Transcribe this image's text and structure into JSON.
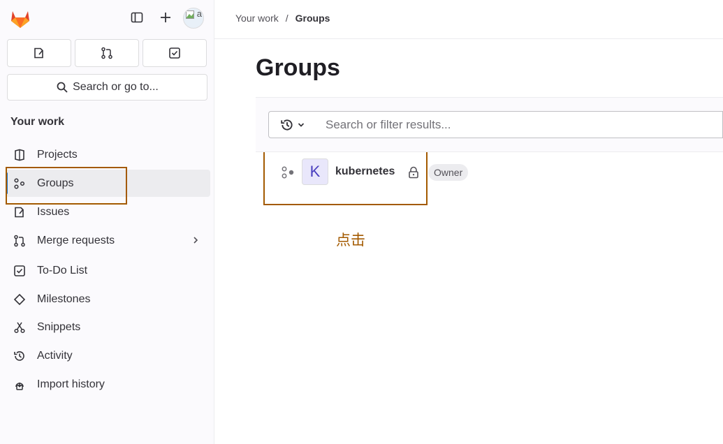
{
  "sidebar": {
    "section_title": "Your work",
    "search_label": "Search or go to...",
    "avatar_alt": "a",
    "items": [
      {
        "label": "Projects"
      },
      {
        "label": "Groups"
      },
      {
        "label": "Issues"
      },
      {
        "label": "Merge requests"
      },
      {
        "label": "To-Do List"
      },
      {
        "label": "Milestones"
      },
      {
        "label": "Snippets"
      },
      {
        "label": "Activity"
      },
      {
        "label": "Import history"
      }
    ]
  },
  "breadcrumb": {
    "parent": "Your work",
    "separator": "/",
    "current": "Groups"
  },
  "main": {
    "title": "Groups",
    "filter_placeholder": "Search or filter results...",
    "groups": [
      {
        "avatar_letter": "K",
        "name": "kubernetes",
        "role": "Owner"
      }
    ]
  },
  "annotation": {
    "text": "点击",
    "color": "#a35a00"
  },
  "colors": {
    "accent": "#1f75cb",
    "highlight_border": "#a35a00"
  }
}
